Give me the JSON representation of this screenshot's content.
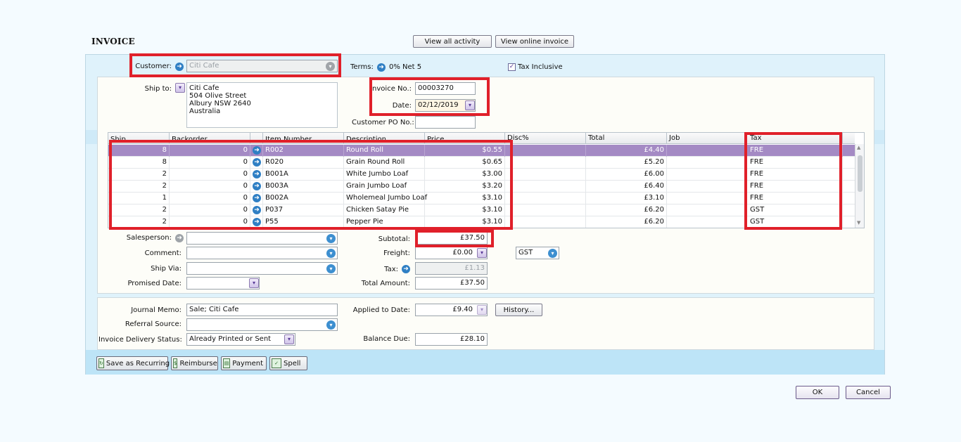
{
  "window": {
    "title": "INVOICE"
  },
  "header_buttons": {
    "view_all_activity": "View all activity",
    "view_online_invoice": "View online invoice"
  },
  "customer": {
    "label": "Customer:",
    "value": "Citi Cafe"
  },
  "terms": {
    "label": "Terms:",
    "value": "0% Net 5"
  },
  "tax_inclusive": {
    "label": "Tax Inclusive",
    "checked": true
  },
  "ship_to": {
    "label": "Ship to:",
    "lines": [
      "Citi Cafe",
      "504 Olive Street",
      "Albury  NSW  2640",
      "Australia"
    ]
  },
  "invoice_no": {
    "label": "Invoice No.:",
    "value": "00003270"
  },
  "date": {
    "label": "Date:",
    "value": "02/12/2019"
  },
  "customer_po": {
    "label": "Customer PO No.:",
    "value": ""
  },
  "grid": {
    "columns": [
      "Ship",
      "Backorder",
      "Item Number",
      "Description",
      "Price",
      "Disc%",
      "Total",
      "Job",
      "Tax"
    ],
    "rows": [
      {
        "ship": "8",
        "backorder": "0",
        "item": "R002",
        "desc": "Round Roll",
        "price": "$0.55",
        "disc": "",
        "total": "£4.40",
        "job": "",
        "tax": "FRE"
      },
      {
        "ship": "8",
        "backorder": "0",
        "item": "R020",
        "desc": "Grain Round Roll",
        "price": "$0.65",
        "disc": "",
        "total": "£5.20",
        "job": "",
        "tax": "FRE"
      },
      {
        "ship": "2",
        "backorder": "0",
        "item": "B001A",
        "desc": "White Jumbo Loaf",
        "price": "$3.00",
        "disc": "",
        "total": "£6.00",
        "job": "",
        "tax": "FRE"
      },
      {
        "ship": "2",
        "backorder": "0",
        "item": "B003A",
        "desc": "Grain Jumbo Loaf",
        "price": "$3.20",
        "disc": "",
        "total": "£6.40",
        "job": "",
        "tax": "FRE"
      },
      {
        "ship": "1",
        "backorder": "0",
        "item": "B002A",
        "desc": "Wholemeal Jumbo Loaf",
        "price": "$3.10",
        "disc": "",
        "total": "£3.10",
        "job": "",
        "tax": "FRE"
      },
      {
        "ship": "2",
        "backorder": "0",
        "item": "P037",
        "desc": "Chicken Satay Pie",
        "price": "$3.10",
        "disc": "",
        "total": "£6.20",
        "job": "",
        "tax": "GST"
      },
      {
        "ship": "2",
        "backorder": "0",
        "item": "P55",
        "desc": "Pepper Pie",
        "price": "$3.10",
        "disc": "",
        "total": "£6.20",
        "job": "",
        "tax": "GST"
      }
    ]
  },
  "salesperson": {
    "label": "Salesperson:",
    "value": ""
  },
  "comment": {
    "label": "Comment:",
    "value": ""
  },
  "ship_via": {
    "label": "Ship Via:",
    "value": ""
  },
  "promised_date": {
    "label": "Promised Date:",
    "value": ""
  },
  "subtotal": {
    "label": "Subtotal:",
    "value": "£37.50"
  },
  "freight": {
    "label": "Freight:",
    "value": "£0.00",
    "tax_code": "GST"
  },
  "tax": {
    "label": "Tax:",
    "value": "£1.13"
  },
  "total_amount": {
    "label": "Total Amount:",
    "value": "£37.50"
  },
  "journal_memo": {
    "label": "Journal Memo:",
    "value": "Sale; Citi Cafe"
  },
  "referral_source": {
    "label": "Referral Source:",
    "value": ""
  },
  "delivery_status": {
    "label": "Invoice Delivery Status:",
    "value": "Already Printed or Sent"
  },
  "applied_to_date": {
    "label": "Applied to Date:",
    "value": "£9.40"
  },
  "history_button": "History...",
  "balance_due": {
    "label": "Balance Due:",
    "value": "£28.10"
  },
  "bottom_buttons": {
    "save_recurring": "Save as Recurring",
    "reimburse": "Reimburse",
    "payment": "Payment",
    "spell": "Spell"
  },
  "dialog_buttons": {
    "ok": "OK",
    "cancel": "Cancel"
  },
  "colors": {
    "highlight": "#e0202a",
    "selected_row": "#a48ac4",
    "panel_blue": "#dff2fb"
  }
}
